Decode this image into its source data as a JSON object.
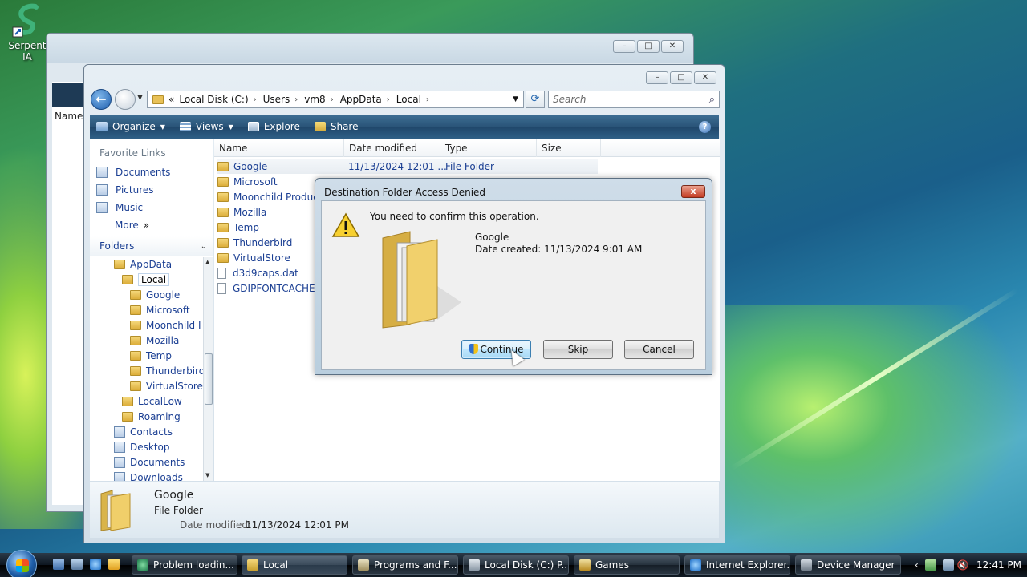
{
  "desktop": {
    "icon_label": "Serpent IA"
  },
  "explorer": {
    "address": {
      "overflow": "«",
      "crumbs": [
        "Local Disk (C:)",
        "Users",
        "vm8",
        "AppData",
        "Local"
      ]
    },
    "search_placeholder": "Search",
    "toolbar": {
      "organize": "Organize",
      "views": "Views",
      "explore": "Explore",
      "share": "Share"
    },
    "nav": {
      "favorites_header": "Favorite Links",
      "favorites": [
        "Documents",
        "Pictures",
        "Music"
      ],
      "more": "More",
      "folders_header": "Folders"
    },
    "tree": [
      "AppData",
      "Local",
      "Google",
      "Microsoft",
      "Moonchild I",
      "Mozilla",
      "Temp",
      "Thunderbird",
      "VirtualStore",
      "LocalLow",
      "Roaming",
      "Contacts",
      "Desktop",
      "Documents",
      "Downloads"
    ],
    "columns": [
      "Name",
      "Date modified",
      "Type",
      "Size"
    ],
    "files": [
      {
        "name": "Google",
        "date": "11/13/2024 12:01 ...",
        "type": "File Folder"
      },
      {
        "name": "Microsoft"
      },
      {
        "name": "Moonchild Produc"
      },
      {
        "name": "Mozilla"
      },
      {
        "name": "Temp"
      },
      {
        "name": "Thunderbird"
      },
      {
        "name": "VirtualStore"
      },
      {
        "name": "d3d9caps.dat"
      },
      {
        "name": "GDIPFONTCACHEV"
      }
    ],
    "details": {
      "name": "Google",
      "type": "File Folder",
      "date_label": "Date modified:",
      "date_value": "11/13/2024 12:01 PM"
    }
  },
  "back_window": {
    "name_header": "Name"
  },
  "dialog": {
    "title": "Destination Folder Access Denied",
    "close": "x",
    "message": "You need to confirm this operation.",
    "item_name": "Google",
    "item_date": "Date created: 11/13/2024 9:01 AM",
    "buttons": {
      "continue": "Continue",
      "skip": "Skip",
      "cancel": "Cancel"
    }
  },
  "taskbar": {
    "buttons": [
      "Problem loadin...",
      "Local",
      "Programs and F...",
      "Local Disk (C:) P...",
      "Games",
      "Internet Explorer...",
      "Device Manager"
    ],
    "clock": "12:41 PM"
  },
  "colors": {
    "link": "#1b3f93",
    "toolbar": "#2a5478",
    "dialog_frame": "#b9cede",
    "taskbar": "#0d1620"
  }
}
